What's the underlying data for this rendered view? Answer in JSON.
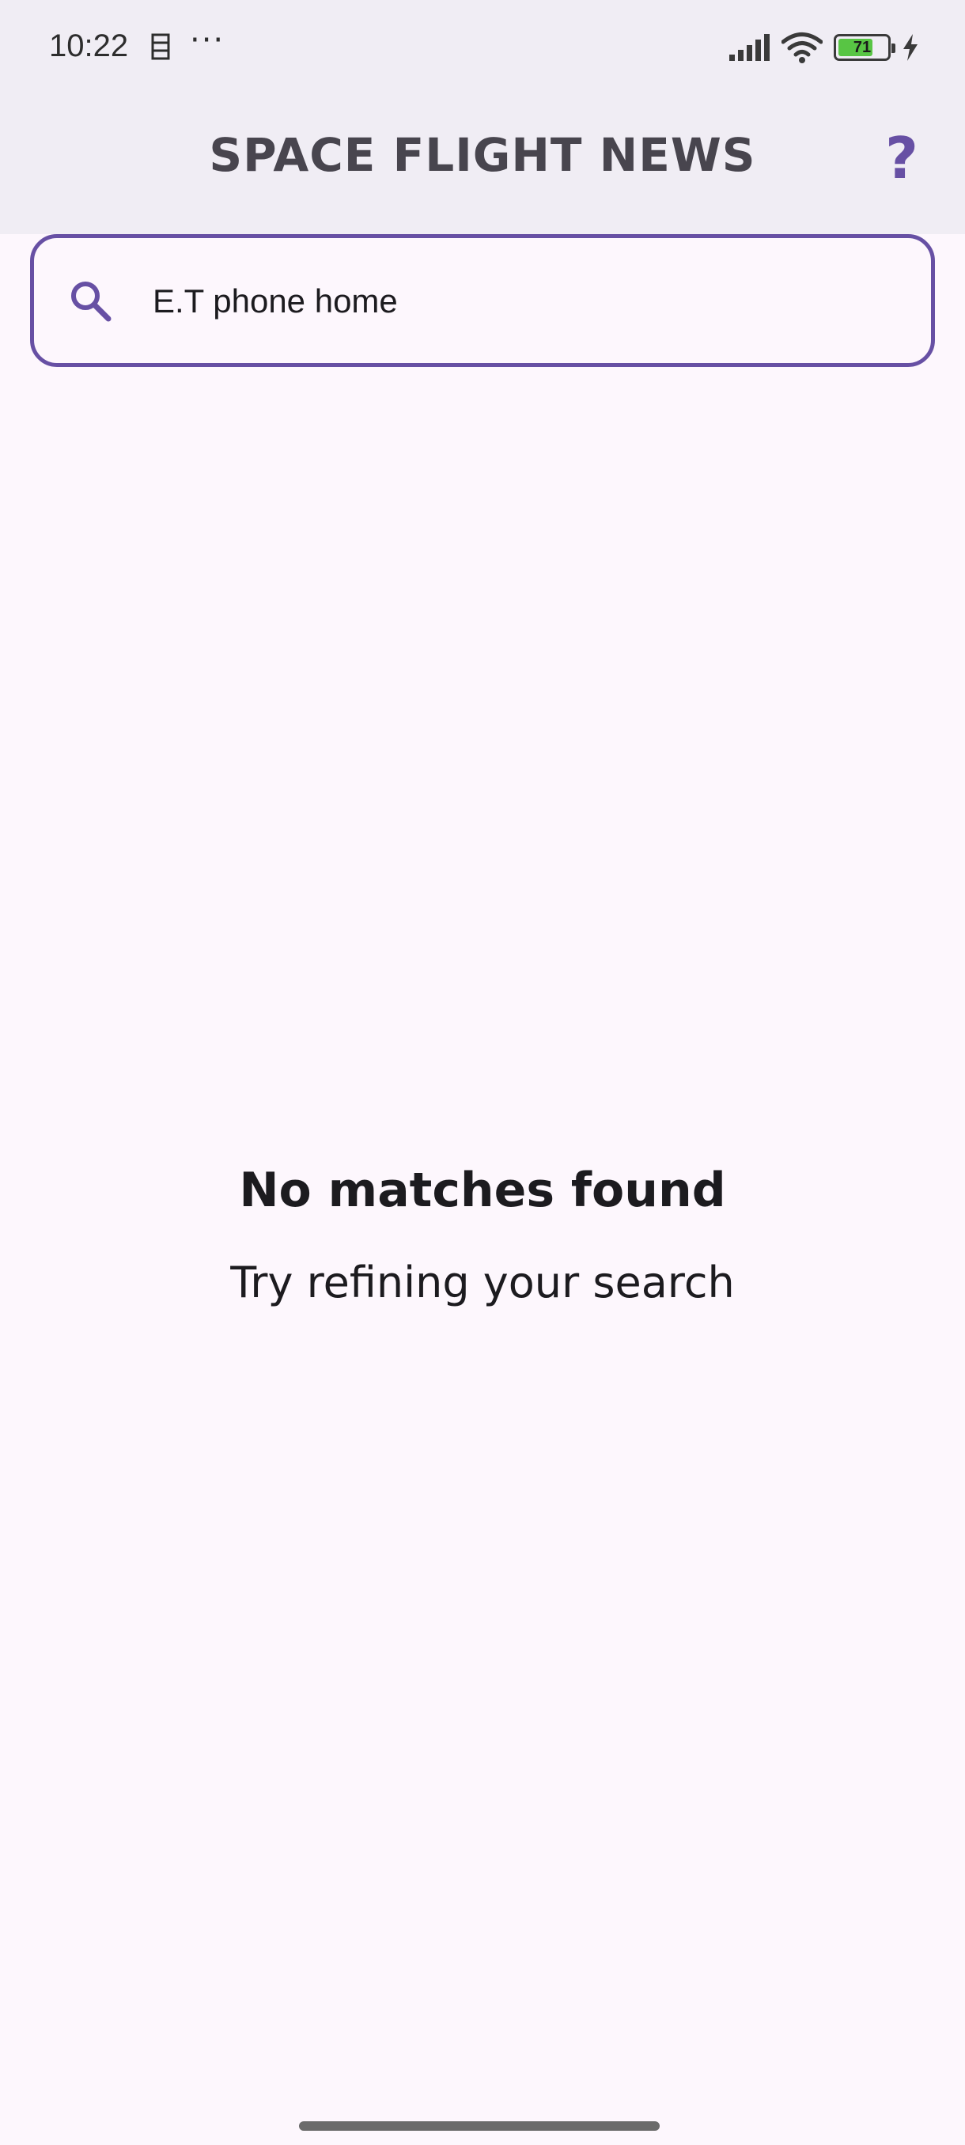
{
  "status_bar": {
    "time": "10:22",
    "dots": "···",
    "battery_level": "71",
    "notification_icon": "calendar-icon",
    "signal_icon": "cellular-signal-icon",
    "wifi_icon": "wifi-icon",
    "charging_icon": "charging-bolt-icon"
  },
  "header": {
    "title": "SPACE FLIGHT NEWS",
    "help_label": "?"
  },
  "search": {
    "value": "E.T phone home",
    "icon": "search-icon"
  },
  "empty_state": {
    "title": "No matches found",
    "subtitle": "Try refining your search"
  },
  "colors": {
    "accent": "#6750a4",
    "background": "#fdf7fd",
    "header_background": "#f0edf4",
    "battery_fill": "#58c544"
  }
}
